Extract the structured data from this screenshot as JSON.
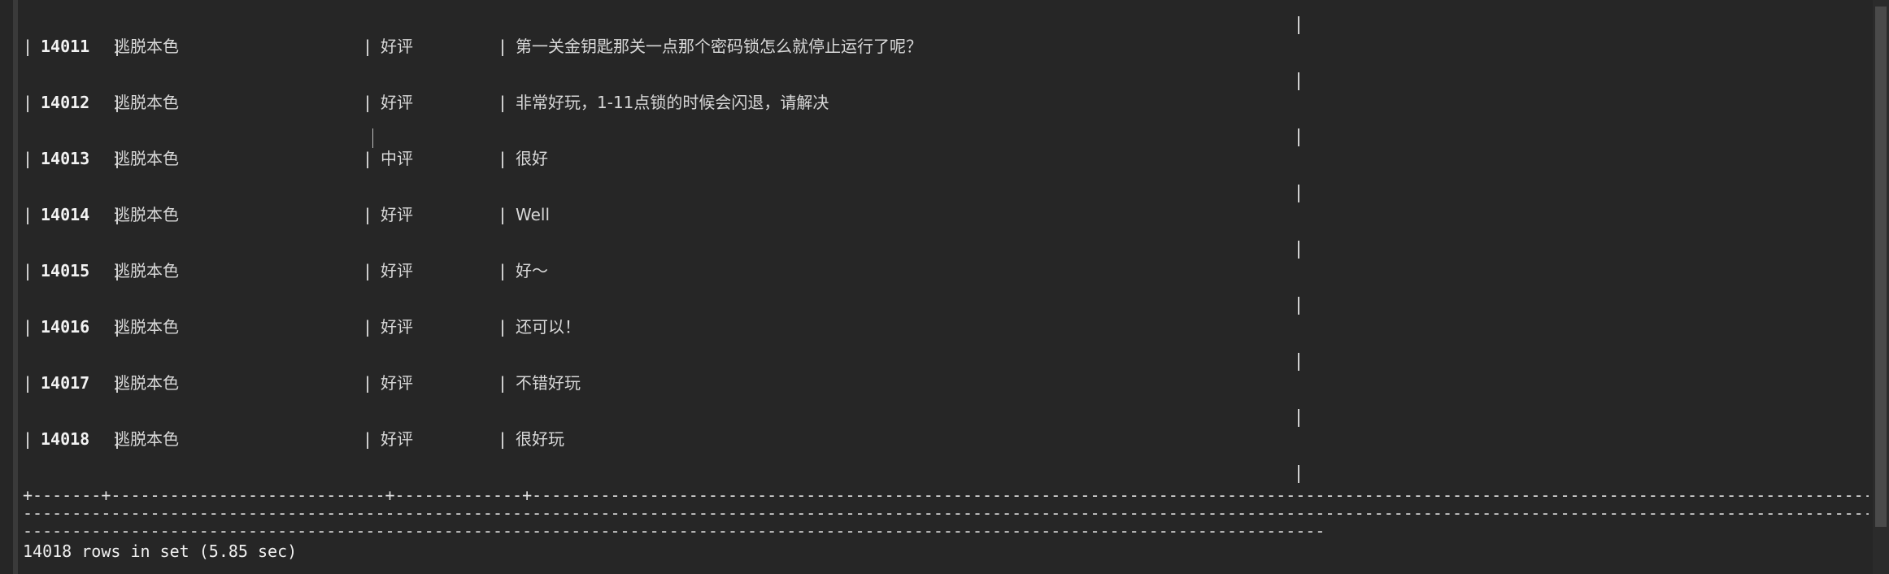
{
  "rows": [
    {
      "id": "14011",
      "app": "逃脱本色",
      "rating": "好评",
      "comment": "第一关金钥匙那关一点那个密码锁怎么就停止运行了呢？"
    },
    {
      "id": "14012",
      "app": "逃脱本色",
      "rating": "好评",
      "comment": "非常好玩，1-11点锁的时候会闪退，请解决"
    },
    {
      "id": "14013",
      "app": "逃脱本色",
      "rating": "中评",
      "comment": "很好"
    },
    {
      "id": "14014",
      "app": "逃脱本色",
      "rating": "好评",
      "comment": "Well"
    },
    {
      "id": "14015",
      "app": "逃脱本色",
      "rating": "好评",
      "comment": "好～"
    },
    {
      "id": "14016",
      "app": "逃脱本色",
      "rating": "好评",
      "comment": "还可以！"
    },
    {
      "id": "14017",
      "app": "逃脱本色",
      "rating": "好评",
      "comment": "不错好玩"
    },
    {
      "id": "14018",
      "app": "逃脱本色",
      "rating": "好评",
      "comment": "很好玩"
    }
  ],
  "table_border": {
    "line1": "+-------+----------------------------+-------------+----------------------------------------------------------------------------------------------------------------------------------------------------------------------------------------------------------",
    "line2": "------------------------------------------------------------------------------------------------------------------------------------------------------------------------------------------------------------------------------------------------------------",
    "line3": "------------------------------------------------------------------------------------------------------------------------------------------------+"
  },
  "status": "14018 rows in set (5.85 sec)",
  "colors": {
    "background": "#262626",
    "text": "#e0e0e0"
  }
}
